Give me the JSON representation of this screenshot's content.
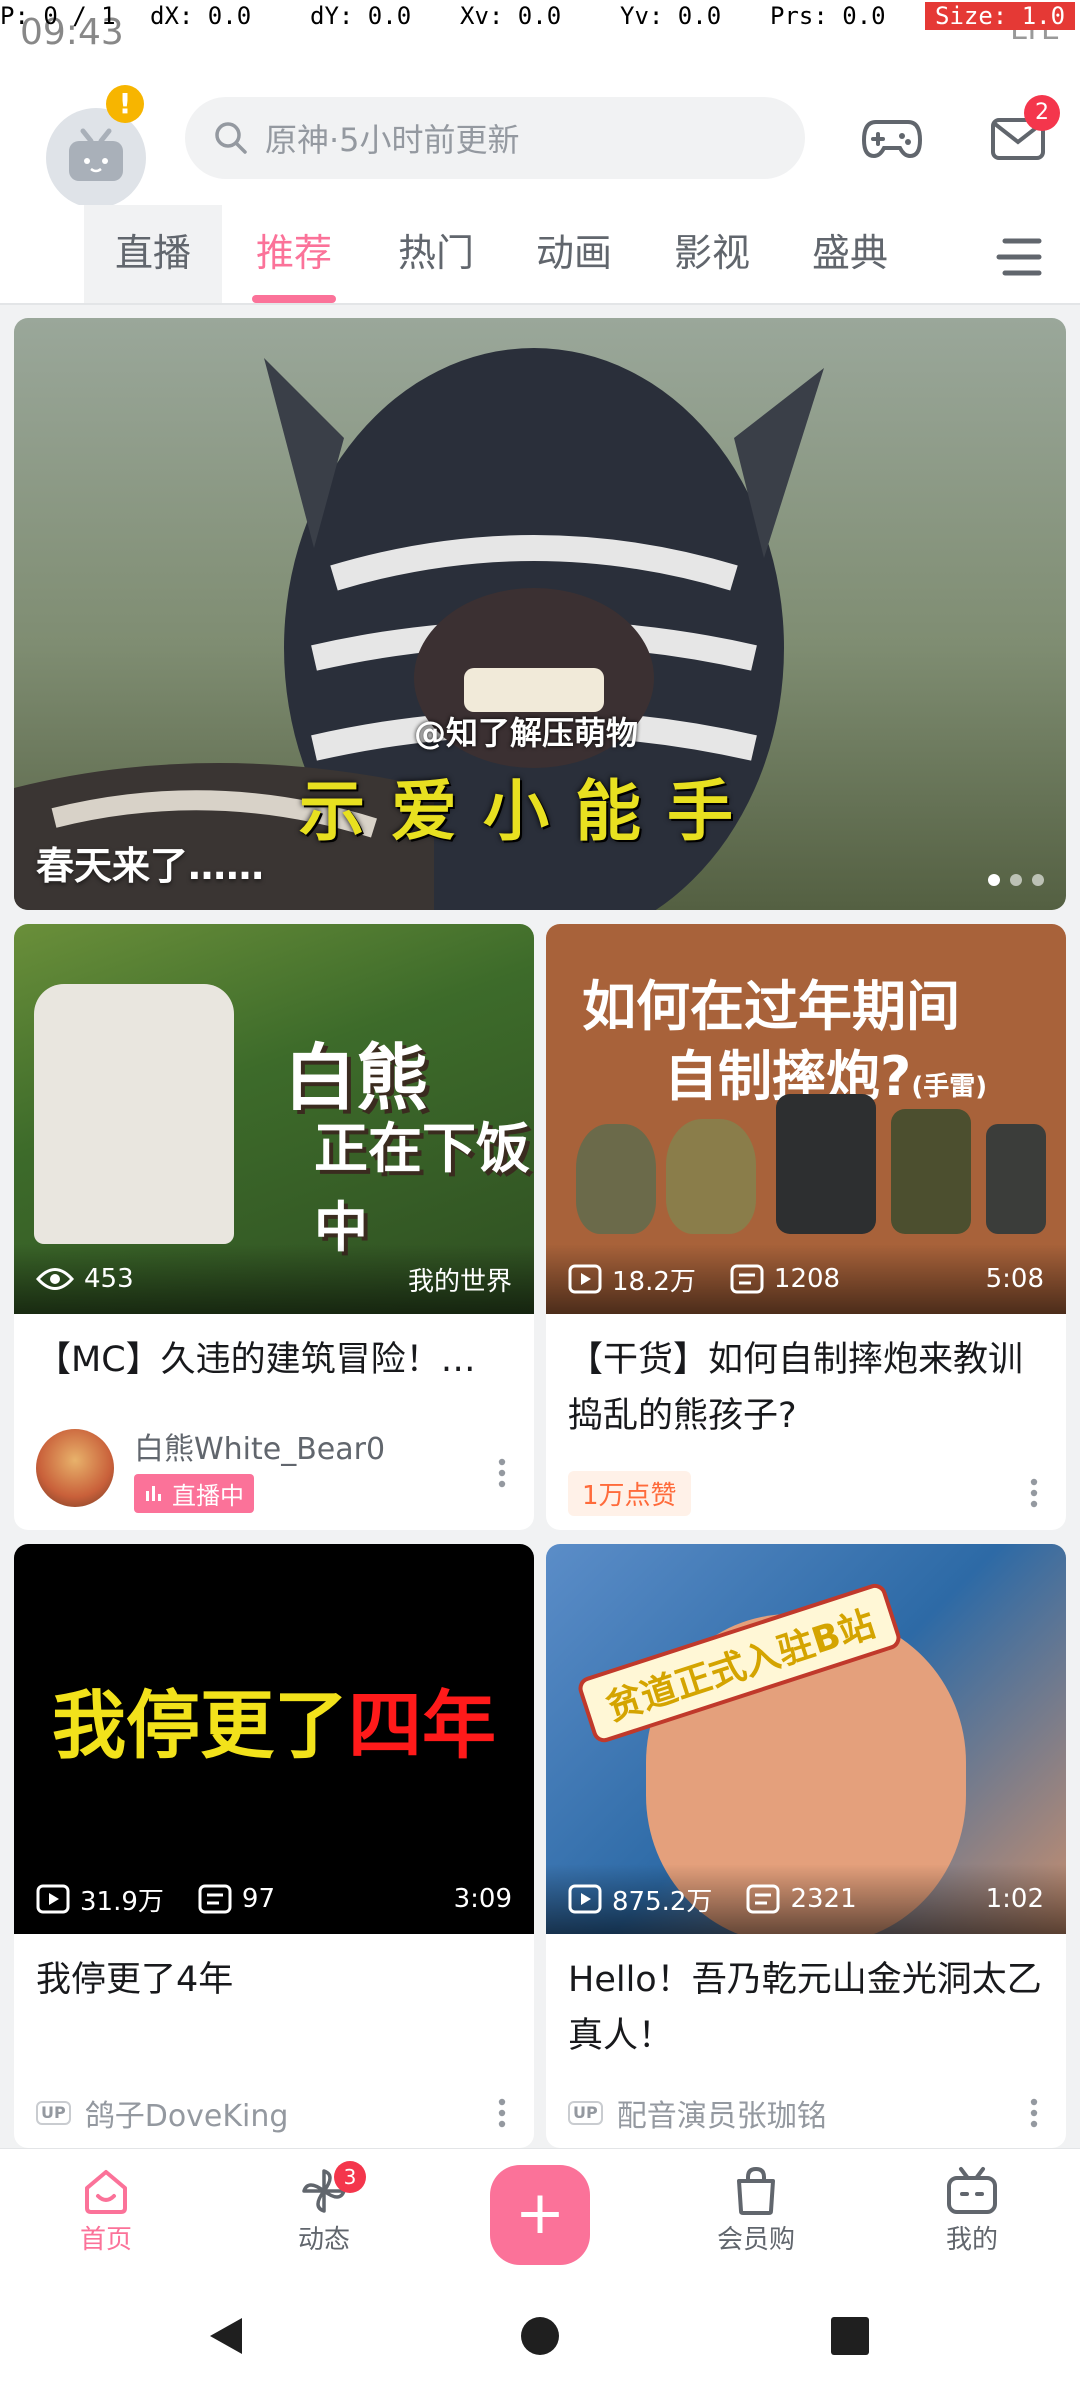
{
  "status": {
    "time": "09:43",
    "right_text": "LTE",
    "pointer": {
      "p": "P: 0 / 1",
      "dx": "dX: 0.0",
      "dy": "dY: 0.0",
      "xv": "Xv: 0.0",
      "yv": "Yv: 0.0",
      "prs": "Prs: 0.0",
      "size": "Size: 1.0"
    }
  },
  "header": {
    "avatar_badge": "!",
    "search_placeholder": "原神·5小时前更新",
    "mail_badge": "2"
  },
  "tabs": [
    {
      "label": "直播"
    },
    {
      "label": "推荐"
    },
    {
      "label": "热门"
    },
    {
      "label": "动画"
    },
    {
      "label": "影视"
    },
    {
      "label": "盛典"
    }
  ],
  "banner": {
    "title": "春天来了……",
    "caption_small": "@知了解压萌物",
    "caption_big": "示爱小能手",
    "dots": 3,
    "active_dot": 0
  },
  "cards": [
    {
      "thumb_text_1": "白熊",
      "thumb_text_2": "正在下饭中",
      "views": "453",
      "tag": "我的世界",
      "title": "【MC】久违的建筑冒险！…",
      "author": "白熊White_Bear0",
      "live_label": "直播中"
    },
    {
      "thumb_text_1": "如何在过年期间",
      "thumb_text_2": "自制摔炮?",
      "thumb_text_3": "(手雷)",
      "plays": "18.2万",
      "danmaku": "1208",
      "duration": "5:08",
      "title": "【干货】如何自制摔炮来教训捣乱的熊孩子?",
      "likes": "1万点赞"
    },
    {
      "thumb_text_1": "我停更了",
      "thumb_text_2": "四年",
      "plays": "31.9万",
      "danmaku": "97",
      "duration": "3:09",
      "title": "我停更了4年",
      "author": "鸽子DoveKing"
    },
    {
      "thumb_text": "贫道正式入驻B站",
      "plays": "875.2万",
      "danmaku": "2321",
      "duration": "1:02",
      "title": "Hello！吾乃乾元山金光洞太乙真人！",
      "author": "配音演员张珈铭"
    }
  ],
  "up_label": "UP",
  "bottom_nav": [
    {
      "label": "首页"
    },
    {
      "label": "动态",
      "badge": "3"
    },
    {
      "label": "+"
    },
    {
      "label": "会员购"
    },
    {
      "label": "我的"
    }
  ],
  "colors": {
    "accent": "#fb7299",
    "badge": "#f4364c",
    "live_tab_bg": "#f1f2f3"
  }
}
